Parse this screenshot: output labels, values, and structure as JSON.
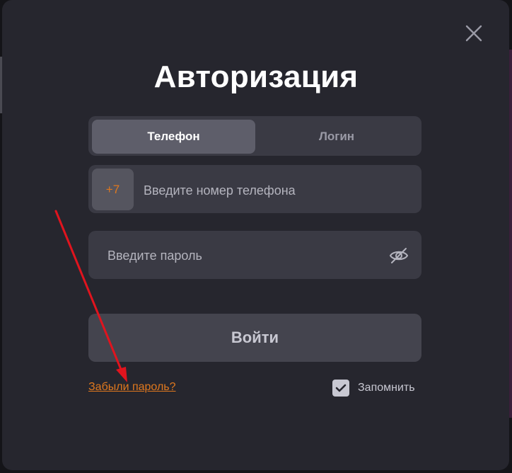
{
  "dialog": {
    "title": "Авторизация",
    "close_icon": "close-icon"
  },
  "tabs": [
    {
      "label": "Телефон",
      "active": true
    },
    {
      "label": "Логин",
      "active": false
    }
  ],
  "phone": {
    "prefix": "+7",
    "value": "",
    "placeholder": "Введите номер телефона"
  },
  "password": {
    "value": "",
    "placeholder": "Введите пароль",
    "toggle_icon": "eye-off-icon"
  },
  "submit": {
    "label": "Войти"
  },
  "forgot": {
    "label": "Забыли пароль?"
  },
  "remember": {
    "label": "Запомнить",
    "checked": true
  },
  "colors": {
    "accent": "#e0781e",
    "modal_bg": "#26262e",
    "field_bg": "#3a3a44",
    "annotation": "#e0141e"
  }
}
